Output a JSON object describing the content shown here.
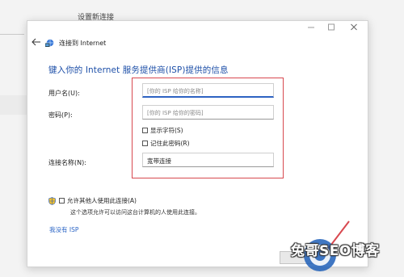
{
  "background": {
    "title": "设置新连接"
  },
  "dialog": {
    "title": "连接到 Internet",
    "heading": "键入你的 Internet 服务提供商(ISP)提供的信息",
    "username_label": "用户名(U):",
    "username_placeholder": "[你的 ISP 给你的名称]",
    "password_label": "密码(P):",
    "password_placeholder": "[你的 ISP 给你的密码]",
    "show_chars_label": "显示字符(S)",
    "remember_label": "记住此密码(R)",
    "connection_name_label": "连接名称(N):",
    "connection_name_value": "宽带连接",
    "allow_others_label": "允许其他人使用此连接(A)",
    "allow_others_note": "这个选项允许可以访问这台计算机的人使用此连接。",
    "no_isp_link": "我没有 ISP"
  },
  "watermark": {
    "text": "兔哥SEO博客"
  },
  "colors": {
    "heading_blue": "#1d4fa8",
    "link_blue": "#2a64c5",
    "highlight_red": "#d8484f"
  }
}
